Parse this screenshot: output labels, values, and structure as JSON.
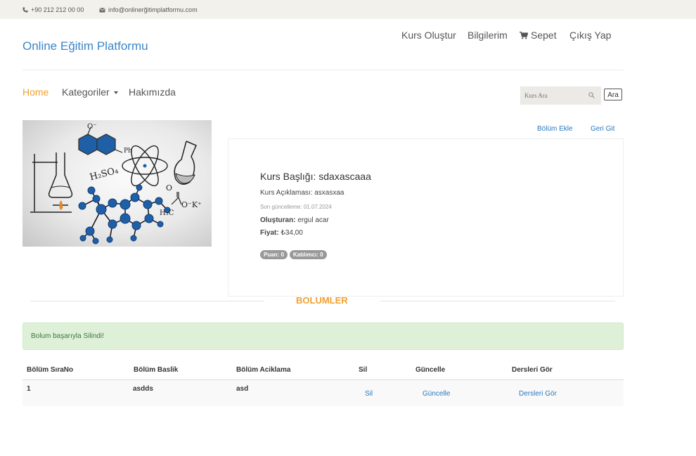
{
  "topbar": {
    "phone": "+90 212 212 00 00",
    "email": "info@onlinerğitimplatformu.com",
    "phone_icon": "phone-icon",
    "email_icon": "envelope-icon"
  },
  "brand": "Online Eğitim Platformu",
  "user_nav": {
    "create_course": "Kurs Oluştur",
    "my_info": "Bilgilerim",
    "cart": "Sepet",
    "cart_icon": "cart-icon",
    "logout": "Çıkış Yap"
  },
  "main_nav": {
    "home": "Home",
    "categories": "Kategoriler",
    "about": "Hakımızda"
  },
  "search": {
    "placeholder": "Kurs Ara",
    "button": "Ara",
    "icon": "search-icon"
  },
  "actions": {
    "add_section": "Bölüm Ekle",
    "back": "Geri Git"
  },
  "course": {
    "image_text": {
      "h2so4": "H₂SO₄",
      "ph": "Ph",
      "h3c": "H₃C",
      "oxygen": "O",
      "o_top": "O⁻",
      "ok": "O⁻K⁺"
    },
    "title": "Kurs Başlığı: sdaxascaaa",
    "description": "Kurs Açıklaması: asxasxaa",
    "updated": "Son güncelleme: 01.07.2024",
    "creator_label": "Oluşturan:",
    "creator": "ergul acar",
    "price_label": "Fiyat:",
    "price": "₺34,00",
    "badge_rating": "Puan: 0",
    "badge_participants": "Katılımcı: 0"
  },
  "sections_title": "BOLUMLER",
  "alert": "Bolum başarıyla Silindi!",
  "colors": {
    "accent_orange": "#f0a030",
    "link_blue": "#2a78c0",
    "brand_blue": "#3a86c8",
    "alert_green_bg": "#dff0d8",
    "alert_green_text": "#3c763d"
  },
  "table": {
    "headers": [
      "Bölüm SıraNo",
      "Bölüm Baslik",
      "Bölüm Aciklama",
      "Sil",
      "Güncelle",
      "Dersleri Gör"
    ],
    "rows": [
      {
        "no": "1",
        "title": "asdds",
        "desc": "asd",
        "delete": "Sil",
        "update": "Güncelle",
        "view": "Dersleri Gör"
      }
    ]
  }
}
